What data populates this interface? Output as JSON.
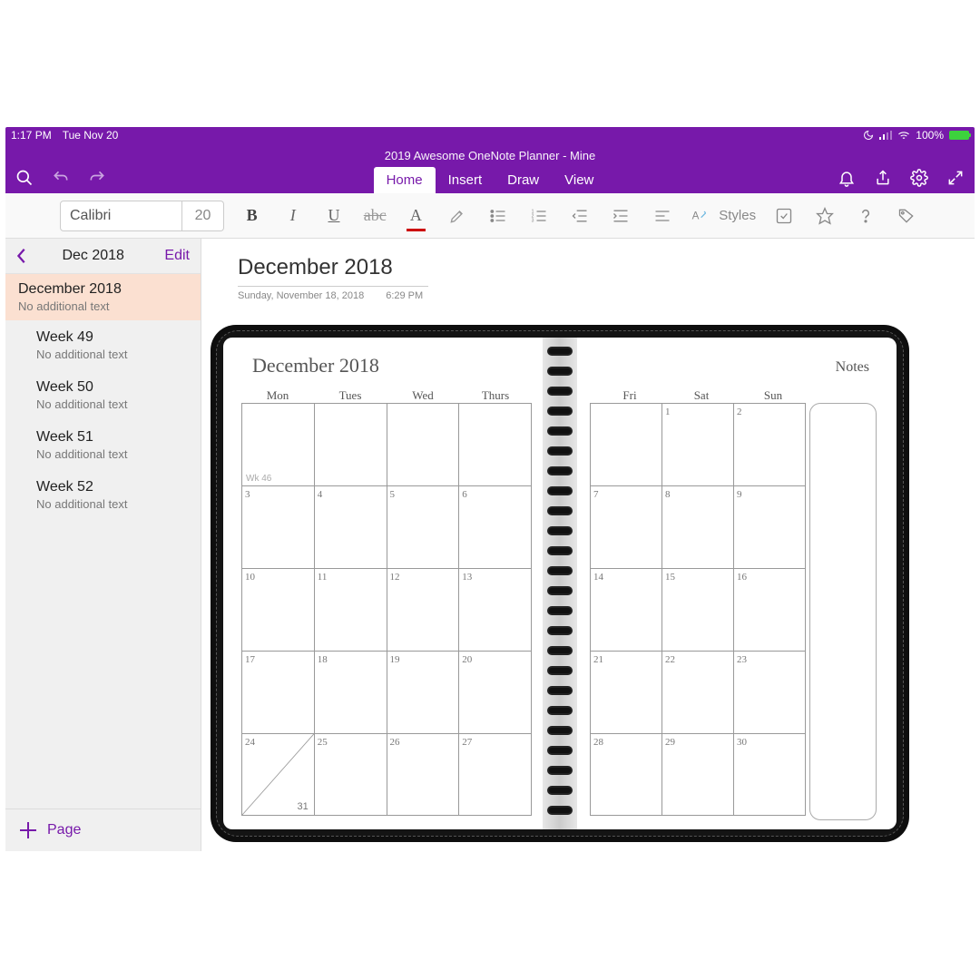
{
  "status": {
    "time": "1:17 PM",
    "date": "Tue Nov 20",
    "battery": "100%"
  },
  "doc_title": "2019 Awesome OneNote Planner - Mine",
  "tabs": {
    "home": "Home",
    "insert": "Insert",
    "draw": "Draw",
    "view": "View"
  },
  "toolbar": {
    "font_name": "Calibri",
    "font_size": "20",
    "styles_label": "Styles"
  },
  "sidebar": {
    "section": "Dec 2018",
    "edit": "Edit",
    "add_page": "Page",
    "items": [
      {
        "label": "December 2018",
        "sub": "No additional text",
        "selected": true,
        "level": 0
      },
      {
        "label": "Week 49",
        "sub": "No additional text",
        "selected": false,
        "level": 1
      },
      {
        "label": "Week 50",
        "sub": "No additional text",
        "selected": false,
        "level": 1
      },
      {
        "label": "Week 51",
        "sub": "No additional text",
        "selected": false,
        "level": 1
      },
      {
        "label": "Week 52",
        "sub": "No additional text",
        "selected": false,
        "level": 1
      }
    ]
  },
  "page": {
    "title": "December 2018",
    "date": "Sunday, November 18, 2018",
    "time": "6:29 PM"
  },
  "planner": {
    "title": "December 2018",
    "notes_label": "Notes",
    "days_left": [
      "Mon",
      "Tues",
      "Wed",
      "Thurs"
    ],
    "days_right": [
      "Fri",
      "Sat",
      "Sun"
    ],
    "week_label": "Wk 46",
    "rows_left": [
      [
        "",
        "",
        "",
        ""
      ],
      [
        "3",
        "4",
        "5",
        "6"
      ],
      [
        "10",
        "11",
        "12",
        "13"
      ],
      [
        "17",
        "18",
        "19",
        "20"
      ],
      [
        "24",
        "25",
        "26",
        "27"
      ]
    ],
    "rows_right": [
      [
        "",
        "1",
        "2"
      ],
      [
        "7",
        "8",
        "9"
      ],
      [
        "14",
        "15",
        "16"
      ],
      [
        "21",
        "22",
        "23"
      ],
      [
        "28",
        "29",
        "30"
      ]
    ],
    "overflow_day": "31"
  }
}
